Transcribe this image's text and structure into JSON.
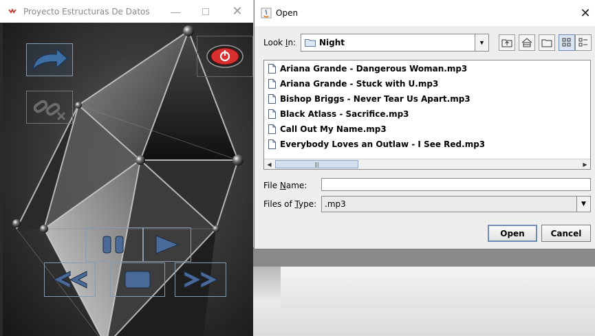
{
  "player": {
    "title": "Proyecto Estructuras De Datos",
    "titlebar_buttons": [
      "minimize",
      "maximize",
      "close"
    ],
    "controls": [
      {
        "name": "load-button",
        "icon": "curved-arrow-icon"
      },
      {
        "name": "unlink-button",
        "icon": "broken-link-icon"
      },
      {
        "name": "power-button",
        "icon": "power-icon"
      },
      {
        "name": "pause-button",
        "icon": "pause-icon"
      },
      {
        "name": "play-button",
        "icon": "play-icon"
      },
      {
        "name": "previous-button",
        "icon": "rewind-icon"
      },
      {
        "name": "stop-button",
        "icon": "stop-icon"
      },
      {
        "name": "next-button",
        "icon": "fast-forward-icon"
      }
    ]
  },
  "dialog": {
    "title": "Open",
    "look_in_label_pre": "Look ",
    "look_in_label_mn": "I",
    "look_in_label_post": "n:",
    "look_in_value": "Night",
    "toolbar": [
      "up-one-level-icon",
      "home-icon",
      "new-folder-icon",
      "list-view-icon",
      "details-view-icon"
    ],
    "files": [
      "Ariana Grande - Dangerous Woman.mp3",
      "Ariana Grande - Stuck with U.mp3",
      "Bishop Briggs - Never Tear Us Apart.mp3",
      "Black Atlass - Sacrifice.mp3",
      "Call Out My Name.mp3",
      "Everybody Loves an Outlaw - I See Red.mp3"
    ],
    "file_name_label_pre": "File ",
    "file_name_label_mn": "N",
    "file_name_label_post": "ame:",
    "file_name_value": "",
    "files_of_type_label_pre": "Files of ",
    "files_of_type_label_mn": "T",
    "files_of_type_label_post": "ype:",
    "files_of_type_value": ".mp3",
    "open_label": "Open",
    "cancel_label": "Cancel"
  },
  "colors": {
    "accent": "#3f5f8f",
    "control_blue": "#4a6a9a",
    "power_red": "#d83030"
  }
}
